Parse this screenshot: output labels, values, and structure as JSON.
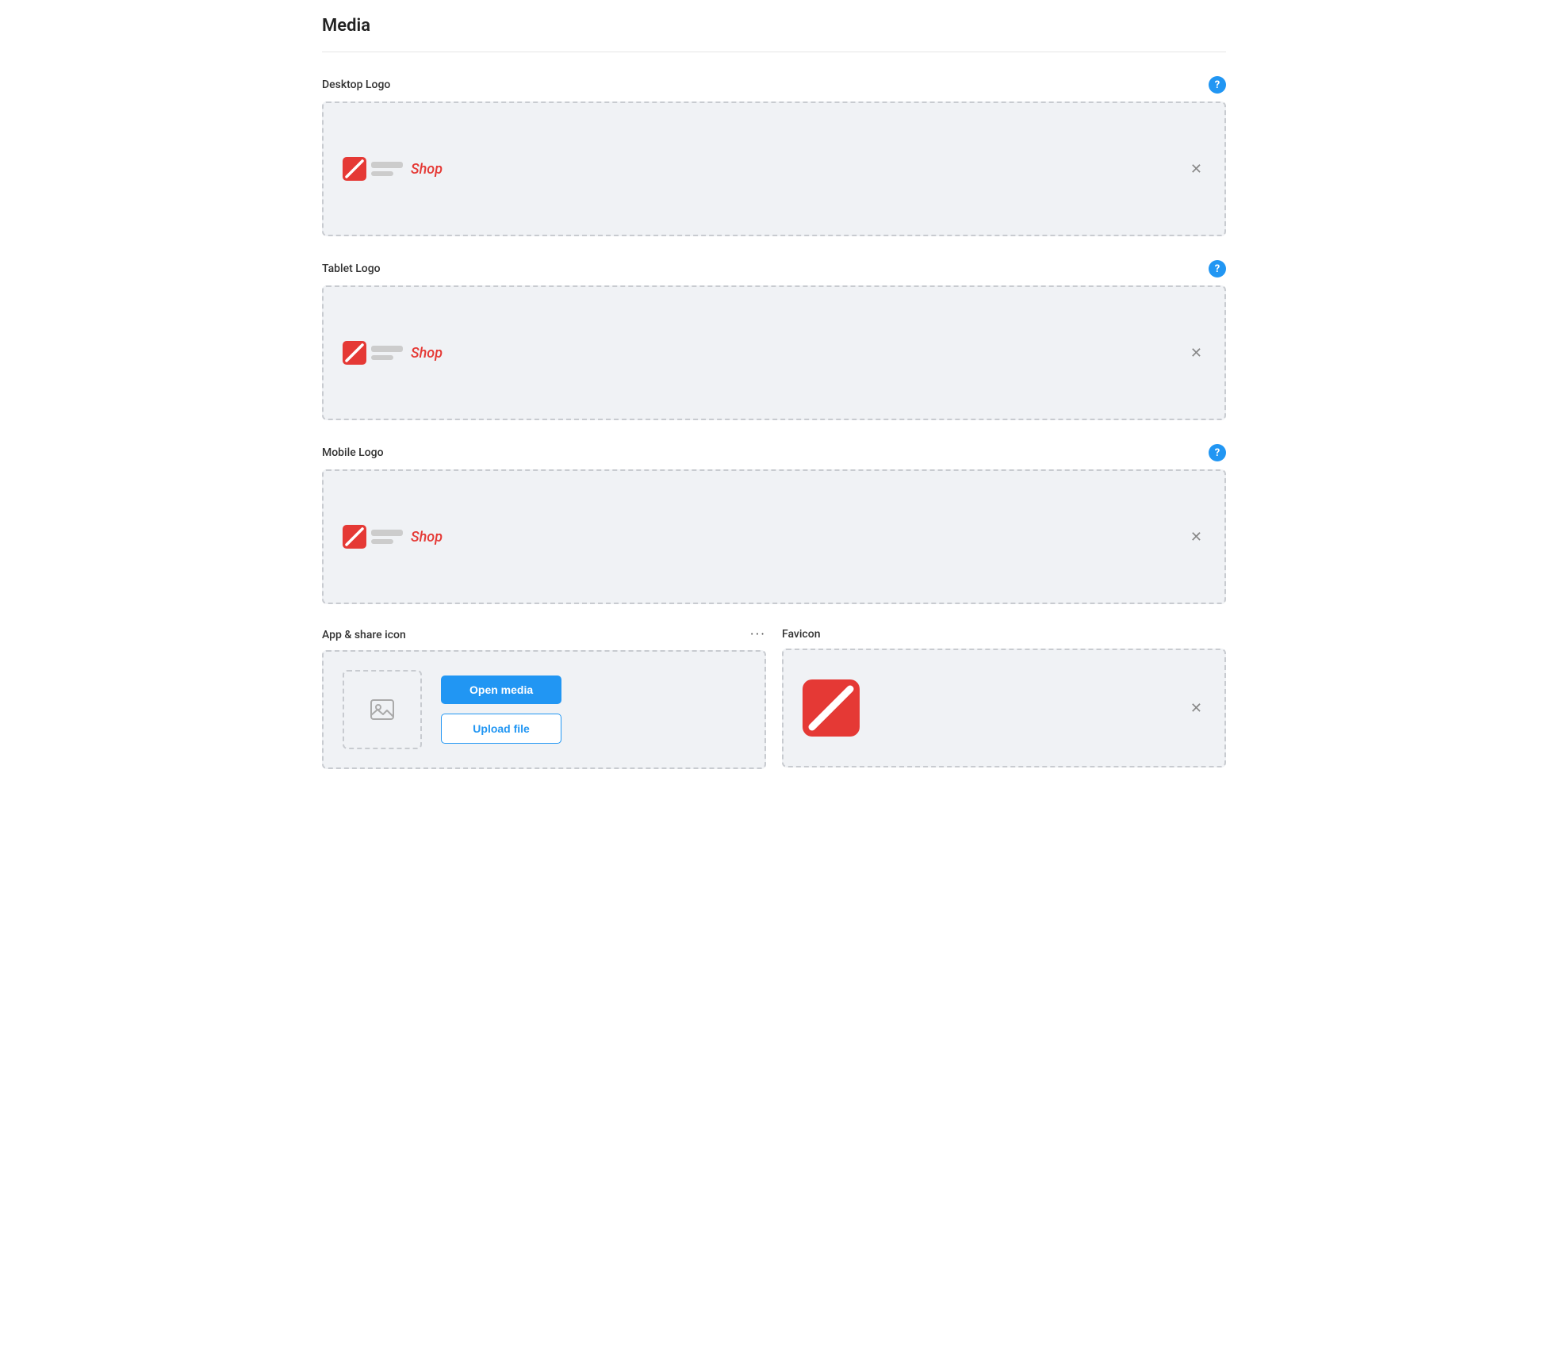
{
  "page": {
    "title": "Media"
  },
  "sections": {
    "desktop_logo": {
      "label": "Desktop Logo",
      "shop_text": "Shop",
      "help_label": "?"
    },
    "tablet_logo": {
      "label": "Tablet Logo",
      "shop_text": "Shop",
      "help_label": "?"
    },
    "mobile_logo": {
      "label": "Mobile Logo",
      "shop_text": "Shop",
      "help_label": "?"
    },
    "app_share_icon": {
      "label": "App & share icon",
      "more_icon": "···",
      "open_media_label": "Open media",
      "upload_file_label": "Upload file"
    },
    "favicon": {
      "label": "Favicon"
    }
  },
  "colors": {
    "accent_blue": "#2196F3",
    "accent_red": "#e53935",
    "border_dashed": "#c8cbd0",
    "bg_dropzone": "#f0f2f5"
  }
}
